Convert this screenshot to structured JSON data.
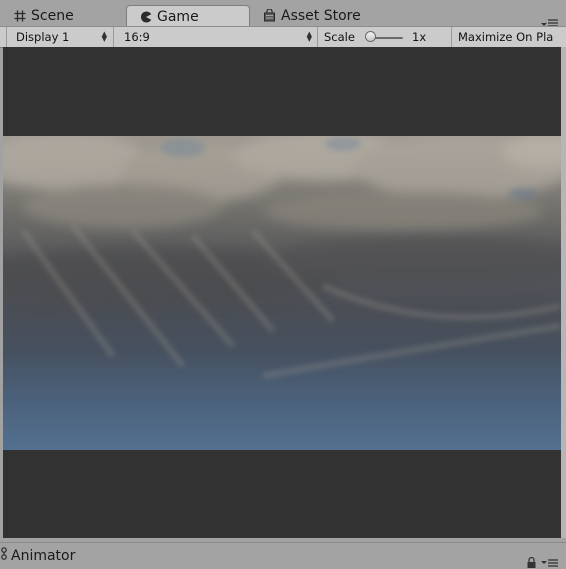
{
  "tabs": [
    {
      "label": "Scene",
      "icon": "grid-icon",
      "active": false
    },
    {
      "label": "Game",
      "icon": "pacman-icon",
      "active": true
    },
    {
      "label": "Asset Store",
      "icon": "shopping-bag-icon",
      "active": false
    }
  ],
  "toolbar": {
    "display": "Display 1",
    "aspect": "16:9",
    "scale_label": "Scale",
    "scale_value": "1x",
    "scale_level": 0.0,
    "maximize": "Maximize On Pla"
  },
  "bottom_panel": {
    "label": "Animator",
    "icon": "animator-icon"
  },
  "colors": {
    "editor_bg": "#a2a2a2",
    "toolbar_bg": "#cbcbcb",
    "game_letterbox": "#323232",
    "sky_top": "#9c9790",
    "sky_bottom": "#53708f"
  }
}
